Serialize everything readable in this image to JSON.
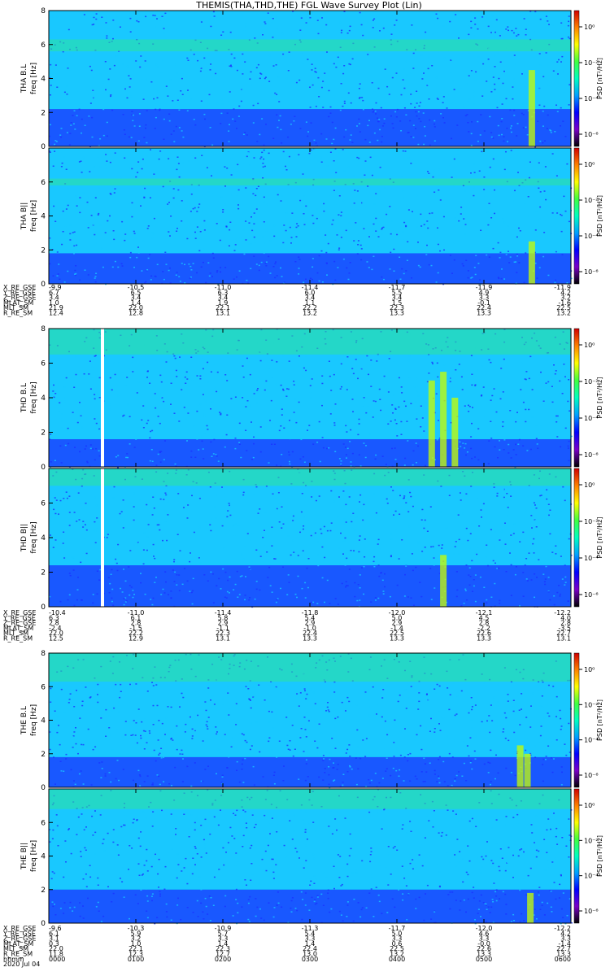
{
  "title": "THEMIS(THA,THD,THE) FGL Wave Survey Plot (Lin)",
  "colors": {
    "background_noise": "#1a33ff",
    "mid_level": "#19c8ff",
    "upper_band": "#2de39a",
    "enhancement": "#c8ff00",
    "colorbar_stops": [
      "#000000",
      "#7a00c8",
      "#0000ff",
      "#00a0ff",
      "#00ffc0",
      "#40ff40",
      "#ffff00",
      "#ff8000",
      "#d00000"
    ]
  },
  "chart_data": [
    {
      "type": "heatmap",
      "probe": "THA",
      "panels": [
        {
          "ylabel": "THA B.L",
          "ysub": "freq [Hz]",
          "ylim": [
            0,
            8
          ],
          "yticks": [
            "0",
            "2",
            "4",
            "6",
            "8"
          ],
          "colorbar_label": "PSD [nT²/Hz]",
          "colorbar_ticks": [
            "10⁰",
            "10⁻²",
            "10⁻⁴",
            "10⁻⁶"
          ],
          "upper_band_hz": [
            5.6,
            6.3
          ],
          "lower_band_hz": [
            0,
            2.2
          ],
          "enhancements": [
            {
              "x_hhmm": "0533",
              "fmax_hz": 4.5
            }
          ]
        },
        {
          "ylabel": "THA B||",
          "ysub": "freq [Hz]",
          "ylim": [
            0,
            8
          ],
          "yticks": [
            "0",
            "2",
            "4",
            "6"
          ],
          "colorbar_label": "PSD [nT²/Hz]",
          "colorbar_ticks": [
            "10⁰",
            "10⁻²",
            "10⁻⁴",
            "10⁻⁶"
          ],
          "upper_band_hz": [
            5.8,
            6.2
          ],
          "lower_band_hz": [
            0,
            1.8
          ],
          "enhancements": [
            {
              "x_hhmm": "0533",
              "fmax_hz": 2.5
            }
          ]
        }
      ],
      "ephemeris": {
        "labels": [
          "X_RE_GSE",
          "Y_RE_GSE",
          "Z_RE_GSE",
          "MLAT_SM",
          "MLT_SM",
          "R_RE_SM"
        ],
        "rows": [
          [
            "-9.9",
            "-10.5",
            "-11.0",
            "-11.4",
            "-11.7",
            "-11.9",
            "-11.9"
          ],
          [
            "6.7",
            "6.5",
            "6.3",
            "6.0",
            "5.5",
            "4.9",
            "4.2"
          ],
          [
            "3.4",
            "3.4",
            "3.4",
            "3.4",
            "3.4",
            "3.3",
            "3.2"
          ],
          [
            "1.0",
            "1.4",
            "1.9",
            "1.1",
            "1.5",
            "-0.1",
            "-1.6"
          ],
          [
            "21.9",
            "22.0",
            "22.1",
            "22.2",
            "22.3",
            "22.4",
            "22.5"
          ],
          [
            "12.4",
            "12.8",
            "13.1",
            "13.2",
            "13.3",
            "13.3",
            "13.2"
          ]
        ]
      }
    },
    {
      "type": "heatmap",
      "probe": "THD",
      "panels": [
        {
          "ylabel": "THD B.L",
          "ysub": "freq [Hz]",
          "ylim": [
            0,
            8
          ],
          "yticks": [
            "0",
            "2",
            "4",
            "6",
            "8"
          ],
          "colorbar_label": "PSD [nT²/Hz]",
          "colorbar_ticks": [
            "10⁰",
            "10⁻²",
            "10⁻⁴",
            "10⁻⁶"
          ],
          "upper_band_hz": [
            6.5,
            8.0
          ],
          "lower_band_hz": [
            0,
            1.6
          ],
          "enhancements": [
            {
              "x_hhmm": "0424",
              "fmax_hz": 5.0
            },
            {
              "x_hhmm": "0432",
              "fmax_hz": 5.5
            },
            {
              "x_hhmm": "0440",
              "fmax_hz": 4.0
            }
          ],
          "data_gap_hhmm": "0037"
        },
        {
          "ylabel": "THD B||",
          "ysub": "freq [Hz]",
          "ylim": [
            0,
            8
          ],
          "yticks": [
            "0",
            "2",
            "4",
            "6"
          ],
          "colorbar_label": "PSD [nT²/Hz]",
          "colorbar_ticks": [
            "10⁰",
            "10⁻²",
            "10⁻⁴",
            "10⁻⁶"
          ],
          "upper_band_hz": [
            7.0,
            8.0
          ],
          "lower_band_hz": [
            0,
            2.4
          ],
          "enhancements": [
            {
              "x_hhmm": "0432",
              "fmax_hz": 3.0
            }
          ],
          "data_gap_hhmm": "0037"
        }
      ],
      "ephemeris": {
        "labels": [
          "X_RE_GSE",
          "Y_RE_GSE",
          "Z_RE_GSE",
          "MLAT_SM",
          "MLT_SM",
          "R_RE_SM"
        ],
        "rows": [
          [
            "-10.4",
            "-11.0",
            "-11.4",
            "-11.8",
            "-12.0",
            "-12.1",
            "-12.2"
          ],
          [
            "6.3",
            "6.1",
            "5.8",
            "5.4",
            "5.0",
            "4.5",
            "4.0"
          ],
          [
            "2.8",
            "2.8",
            "2.9",
            "2.9",
            "2.9",
            "2.8",
            "2.8"
          ],
          [
            "-2.4",
            "-1.5",
            "-1.1",
            "-1.0",
            "-1.4",
            "-2.2",
            "-3.5"
          ],
          [
            "22.0",
            "22.2",
            "22.3",
            "22.4",
            "22.5",
            "22.6",
            "22.7"
          ],
          [
            "12.5",
            "12.9",
            "13.1",
            "13.3",
            "13.3",
            "13.3",
            "13.1"
          ]
        ]
      }
    },
    {
      "type": "heatmap",
      "probe": "THE",
      "panels": [
        {
          "ylabel": "THE B.L",
          "ysub": "freq [Hz]",
          "ylim": [
            0,
            8
          ],
          "yticks": [
            "0",
            "2",
            "4",
            "6",
            "8"
          ],
          "colorbar_label": "PSD [nT²/Hz]",
          "colorbar_ticks": [
            "10⁰",
            "10⁻²",
            "10⁻⁴",
            "10⁻⁶"
          ],
          "upper_band_hz": [
            6.3,
            8.0
          ],
          "lower_band_hz": [
            0,
            1.8
          ],
          "enhancements": [
            {
              "x_hhmm": "0525",
              "fmax_hz": 2.5
            },
            {
              "x_hhmm": "0530",
              "fmax_hz": 2.0
            }
          ]
        },
        {
          "ylabel": "THE B||",
          "ysub": "freq [Hz]",
          "ylim": [
            0,
            8
          ],
          "yticks": [
            "0",
            "2",
            "4",
            "6"
          ],
          "colorbar_label": "PSD [nT²/Hz]",
          "colorbar_ticks": [
            "10⁰",
            "10⁻²",
            "10⁻⁴",
            "10⁻⁶"
          ],
          "upper_band_hz": [
            6.8,
            8.0
          ],
          "lower_band_hz": [
            0,
            2.0
          ],
          "enhancements": [
            {
              "x_hhmm": "0532",
              "fmax_hz": 1.8
            }
          ]
        }
      ],
      "ephemeris": {
        "labels": [
          "X_RE_GSE",
          "Y_RE_GSE",
          "Z_RE_GSE",
          "MLAT_SM",
          "MLT_SM",
          "R_RE_SM",
          "hhmm",
          "2020 Jul 04"
        ],
        "rows": [
          [
            "-9.6",
            "-10.3",
            "-10.9",
            "-11.3",
            "-11.7",
            "-12.0",
            "-12.2"
          ],
          [
            "6.1",
            "5.9",
            "5.7",
            "5.4",
            "5.0",
            "4.6",
            "4.2"
          ],
          [
            "3.1",
            "3.2",
            "3.3",
            "3.3",
            "3.3",
            "3.3",
            "3.3"
          ],
          [
            "0.3",
            "1.0",
            "1.4",
            "1.4",
            "0.6",
            "-0.0",
            "-1.4"
          ],
          [
            "22.0",
            "22.1",
            "22.3",
            "22.4",
            "22.5",
            "22.6",
            "22.7"
          ],
          [
            "11.8",
            "12.3",
            "12.7",
            "13.0",
            "13.2",
            "13.3",
            "13.3"
          ],
          [
            "0000",
            "0100",
            "0200",
            "0300",
            "0400",
            "0500",
            "0600"
          ]
        ]
      }
    }
  ]
}
